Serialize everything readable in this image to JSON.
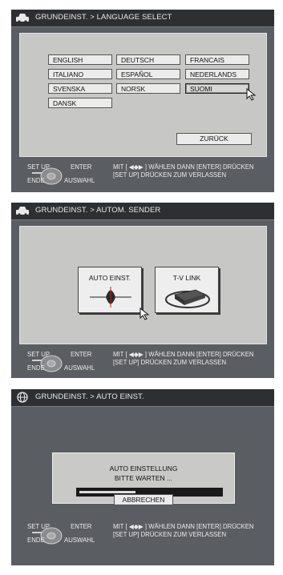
{
  "screens": [
    {
      "title": "GRUNDEINST. > LANGUAGE SELECT",
      "languages": [
        "ENGLISH",
        "DEUTSCH",
        "FRANCAIS",
        "ITALIANO",
        "ESPAÑOL",
        "NEDERLANDS",
        "SVENSKA",
        "NORSK",
        "SUOMI",
        "DANSK"
      ],
      "selected": "SUOMI",
      "back_label": "ZURÜCK",
      "footer": {
        "setup": "SET UP",
        "enter": "ENTER",
        "end": "ENDE",
        "select": "AUSWAHL",
        "hint_line1": "MIT [ ◀◆▶ ] WÄHLEN DANN [ENTER] DRÜCKEN",
        "hint_line2": "[SET UP] DRÜCKEN ZUM VERLASSEN"
      }
    },
    {
      "title": "GRUNDEINST. > AUTOM. SENDER",
      "option1": "AUTO EINST.",
      "option2": "T-V LINK",
      "footer": {
        "setup": "SET UP",
        "enter": "ENTER",
        "end": "ENDE",
        "select": "AUSWAHL",
        "hint_line1": "MIT [ ◀◆▶ ] WÄHLEN DANN [ENTER] DRÜCKEN",
        "hint_line2": "[SET UP] DRÜCKEN ZUM VERLASSEN"
      }
    },
    {
      "title": "GRUNDEINST. > AUTO EINST.",
      "message1": "AUTO EINSTELLUNG",
      "message2": "BITTE WARTEN ...",
      "progress": 0.4,
      "cancel_label": "ABBRECHEN",
      "footer": {
        "setup": "SET UP",
        "enter": "ENTER",
        "end": "ENDE",
        "select": "AUSWAHL",
        "hint_line1": "MIT [ ◀◆▶ ] WÄHLEN DANN [ENTER] DRÜCKEN",
        "hint_line2": "[SET UP] DRÜCKEN ZUM VERLASSEN"
      }
    }
  ],
  "colors": {
    "screen_bg": "#5a5d62",
    "titlebar_bg": "#2d2f33",
    "panel_bg": "#c7c7c5"
  }
}
